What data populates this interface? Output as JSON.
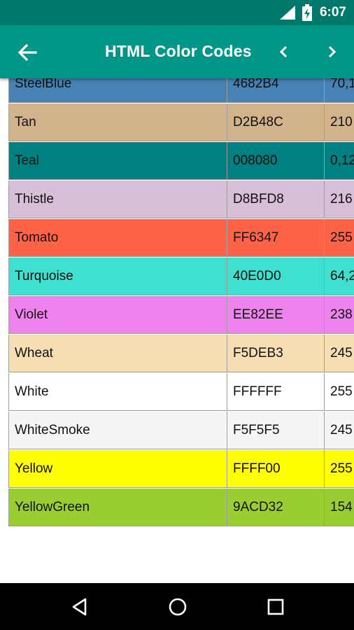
{
  "status_bar": {
    "time": "6:07",
    "icons": [
      "signal-icon",
      "battery-charging-icon"
    ]
  },
  "app_bar": {
    "title": "HTML Color Codes",
    "icons": [
      "arrow-back-icon",
      "chevron-left-icon",
      "chevron-right-icon"
    ]
  },
  "table": {
    "rows": [
      {
        "name": "SteelBlue",
        "hex": "4682B4",
        "rgb": "70,1",
        "color": "#4682B4"
      },
      {
        "name": "Tan",
        "hex": "D2B48C",
        "rgb": "210",
        "color": "#D2B48C"
      },
      {
        "name": "Teal",
        "hex": "008080",
        "rgb": "0,12",
        "color": "#008080"
      },
      {
        "name": "Thistle",
        "hex": "D8BFD8",
        "rgb": "216",
        "color": "#D8BFD8"
      },
      {
        "name": "Tomato",
        "hex": "FF6347",
        "rgb": "255",
        "color": "#FF6347"
      },
      {
        "name": "Turquoise",
        "hex": "40E0D0",
        "rgb": "64,2",
        "color": "#40E0D0"
      },
      {
        "name": "Violet",
        "hex": "EE82EE",
        "rgb": "238",
        "color": "#EE82EE"
      },
      {
        "name": "Wheat",
        "hex": "F5DEB3",
        "rgb": "245",
        "color": "#F5DEB3"
      },
      {
        "name": "White",
        "hex": "FFFFFF",
        "rgb": "255",
        "color": "#FFFFFF"
      },
      {
        "name": "WhiteSmoke",
        "hex": "F5F5F5",
        "rgb": "245",
        "color": "#F5F5F5"
      },
      {
        "name": "Yellow",
        "hex": "FFFF00",
        "rgb": "255",
        "color": "#FFFF00"
      },
      {
        "name": "YellowGreen",
        "hex": "9ACD32",
        "rgb": "154",
        "color": "#9ACD32"
      }
    ]
  },
  "nav_bar": {
    "icons": [
      "back-triangle-icon",
      "home-circle-icon",
      "recents-square-icon"
    ]
  },
  "colors": {
    "status_bar": "#00796B",
    "app_bar": "#009688",
    "nav_bar": "#000000"
  }
}
